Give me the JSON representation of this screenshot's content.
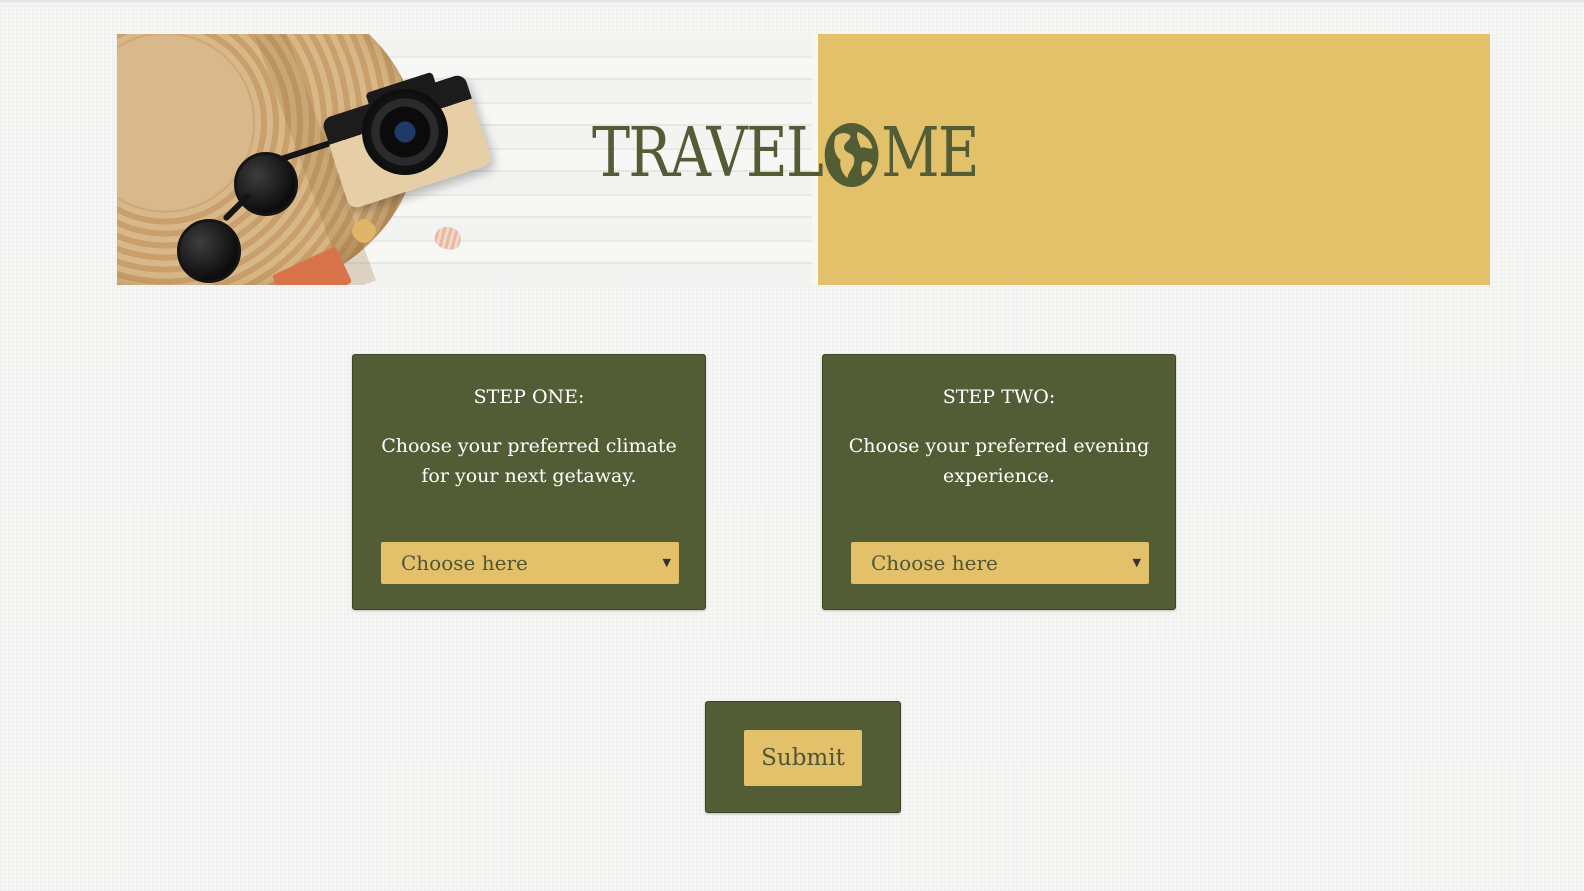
{
  "brand": {
    "logo_before": "TRAVEL",
    "logo_icon": "globe-icon",
    "logo_after": "ME"
  },
  "steps": [
    {
      "title": "STEP ONE:",
      "prompt": "Choose your preferred climate for your next getaway.",
      "select": {
        "selected": "Choose here"
      }
    },
    {
      "title": "STEP TWO:",
      "prompt": "Choose your preferred evening experience.",
      "select": {
        "selected": "Choose here"
      }
    }
  ],
  "submit": {
    "label": "Submit"
  },
  "colors": {
    "olive": "#525d36",
    "gold": "#e3c06a",
    "background": "#f6f6f5",
    "card_text": "#ffffff"
  }
}
